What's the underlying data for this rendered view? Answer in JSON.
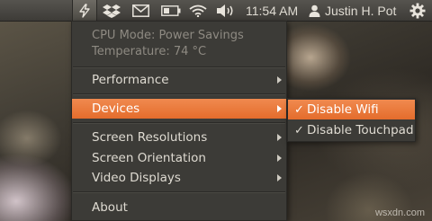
{
  "panel": {
    "tray_icons": [
      "cpu-indicator-icon",
      "dropbox-icon",
      "mail-icon",
      "battery-icon",
      "wifi-icon",
      "volume-icon"
    ],
    "clock": "11:54 AM",
    "user_name": "Justin H. Pot",
    "session_icon": "gear-icon"
  },
  "menu": {
    "info_lines": [
      "CPU Mode: Power Savings",
      "Temperature: 74 °C"
    ],
    "items": {
      "performance": "Performance",
      "devices": "Devices",
      "screen_resolutions": "Screen Resolutions",
      "screen_orientation": "Screen Orientation",
      "video_displays": "Video Displays",
      "about": "About"
    },
    "highlight_color": "#e8743a"
  },
  "submenu": {
    "items": [
      {
        "label": "Disable Wifi",
        "checked": true
      },
      {
        "label": "Disable Touchpad",
        "checked": true
      }
    ]
  },
  "watermark": "wsxdn.com"
}
